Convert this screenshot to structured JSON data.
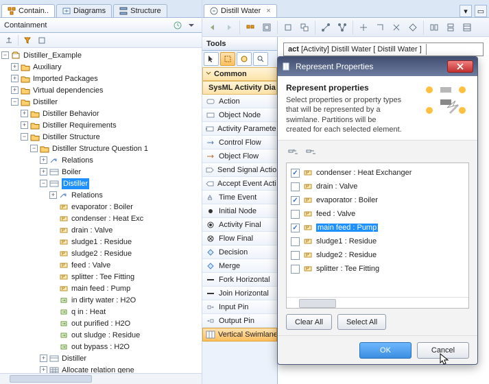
{
  "left_tabs": [
    "Contain..",
    "Diagrams",
    "Structure"
  ],
  "panel_title": "Containment",
  "tree": [
    {
      "d": 0,
      "t": "Distiller_Example",
      "tog": "-",
      "ic": "model"
    },
    {
      "d": 1,
      "t": "Auxiliary",
      "tog": "+",
      "ic": "folder"
    },
    {
      "d": 1,
      "t": "Imported Packages",
      "tog": "+",
      "ic": "folder"
    },
    {
      "d": 1,
      "t": "Virtual dependencies",
      "tog": "+",
      "ic": "folder"
    },
    {
      "d": 1,
      "t": "Distiller",
      "tog": "-",
      "ic": "folder"
    },
    {
      "d": 2,
      "t": "Distiller Behavior",
      "tog": "+",
      "ic": "folder"
    },
    {
      "d": 2,
      "t": "Distiller Requirements",
      "tog": "+",
      "ic": "folder"
    },
    {
      "d": 2,
      "t": "Distiller Structure",
      "tog": "-",
      "ic": "folder"
    },
    {
      "d": 3,
      "t": "Distiller Structure Question 1",
      "tog": "-",
      "ic": "folder"
    },
    {
      "d": 4,
      "t": "Relations",
      "tog": "+",
      "ic": "rel"
    },
    {
      "d": 4,
      "t": "Boiler",
      "tog": "+",
      "ic": "block"
    },
    {
      "d": 4,
      "t": "Distiller",
      "tog": "-",
      "ic": "block",
      "sel": true
    },
    {
      "d": 5,
      "t": "Relations",
      "tog": "+",
      "ic": "rel"
    },
    {
      "d": 5,
      "t": "evaporator : Boiler",
      "ic": "part"
    },
    {
      "d": 5,
      "t": "condenser : Heat Exc",
      "ic": "part"
    },
    {
      "d": 5,
      "t": "drain : Valve",
      "ic": "part"
    },
    {
      "d": 5,
      "t": "sludge1 : Residue",
      "ic": "part"
    },
    {
      "d": 5,
      "t": "sludge2 : Residue",
      "ic": "part"
    },
    {
      "d": 5,
      "t": "feed : Valve",
      "ic": "part"
    },
    {
      "d": 5,
      "t": "splitter : Tee Fitting",
      "ic": "part"
    },
    {
      "d": 5,
      "t": "main feed : Pump",
      "ic": "part"
    },
    {
      "d": 5,
      "t": "in dirty water : H2O",
      "ic": "port"
    },
    {
      "d": 5,
      "t": "q in : Heat",
      "ic": "port"
    },
    {
      "d": 5,
      "t": "out purified : H2O",
      "ic": "port"
    },
    {
      "d": 5,
      "t": "out sludge : Residue",
      "ic": "port"
    },
    {
      "d": 5,
      "t": "out bypass : H2O",
      "ic": "port"
    },
    {
      "d": 4,
      "t": "Distiller",
      "tog": "+",
      "ic": "block"
    },
    {
      "d": 4,
      "t": "Allocate relation gene",
      "tog": "+",
      "ic": "table"
    }
  ],
  "doc_tab": "Distill Water",
  "act_frame": "act [Activity] Distill Water [ Distill Water ]",
  "palette": {
    "title": "Tools",
    "group1": "Common",
    "group2": "SysML Activity Dia",
    "items": [
      "Action",
      "Object Node",
      "Activity Paramete",
      "Control Flow",
      "Object Flow",
      "Send Signal Actio",
      "Accept Event Acti",
      "Time Event",
      "Initial Node",
      "Activity Final",
      "Flow Final",
      "Decision",
      "Merge",
      "Fork Horizontal",
      "Join Horizontal",
      "Input Pin",
      "Output Pin"
    ],
    "selected": "Vertical Swimlanes"
  },
  "dialog": {
    "title": "Represent Properties",
    "header": "Represent properties",
    "desc": "Select properties or property types that will be represented by a swimlane. Partitions will be created for each selected element.",
    "items": [
      {
        "t": "condenser : Heat Exchanger",
        "on": true
      },
      {
        "t": "drain : Valve",
        "on": false
      },
      {
        "t": "evaporator : Boiler",
        "on": true
      },
      {
        "t": "feed : Valve",
        "on": false
      },
      {
        "t": "main feed : Pump",
        "on": true,
        "sel": true
      },
      {
        "t": "sludge1 : Residue",
        "on": false
      },
      {
        "t": "sludge2 : Residue",
        "on": false
      },
      {
        "t": "splitter : Tee Fitting",
        "on": false
      }
    ],
    "clear": "Clear All",
    "select": "Select All",
    "ok": "OK",
    "cancel": "Cancel"
  }
}
